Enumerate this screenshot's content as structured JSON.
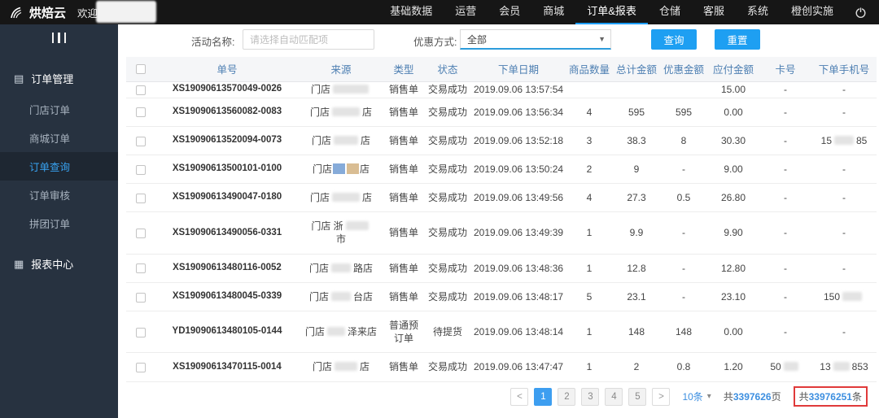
{
  "topnav": {
    "logo": "烘焙云",
    "welcome": "欢迎",
    "items": [
      {
        "label": "基础数据",
        "active": false
      },
      {
        "label": "运营",
        "active": false
      },
      {
        "label": "会员",
        "active": false
      },
      {
        "label": "商城",
        "active": false
      },
      {
        "label": "订单&报表",
        "active": true
      },
      {
        "label": "仓储",
        "active": false
      },
      {
        "label": "客服",
        "active": false
      },
      {
        "label": "系统",
        "active": false
      },
      {
        "label": "橙创实施",
        "active": false
      }
    ]
  },
  "sidebar": {
    "sections": [
      {
        "label": "订单管理",
        "icon": "orders-icon",
        "glyph": "▤",
        "items": [
          {
            "label": "门店订单",
            "active": false
          },
          {
            "label": "商城订单",
            "active": false
          },
          {
            "label": "订单查询",
            "active": true
          },
          {
            "label": "订单审核",
            "active": false
          },
          {
            "label": "拼团订单",
            "active": false
          }
        ]
      },
      {
        "label": "报表中心",
        "icon": "reports-icon",
        "glyph": "▦",
        "items": []
      }
    ]
  },
  "filters": {
    "activity_label": "活动名称:",
    "activity_placeholder": "请选择自动匹配项",
    "discount_label": "优惠方式:",
    "discount_value": "全部",
    "search_button": "查询",
    "reset_button": "重置"
  },
  "table": {
    "headers": [
      "单号",
      "来源",
      "类型",
      "状态",
      "下单日期",
      "商品数量",
      "总计金额",
      "优惠金额",
      "应付金额",
      "卡号",
      "下单手机号"
    ],
    "rows": [
      {
        "cut": true,
        "no": "XS19090613570049-0026",
        "source_pre": "门店",
        "source_blur": 44,
        "source_post": "",
        "type": "销售单",
        "status": "交易成功",
        "date": "2019.09.06 13:57:54",
        "qty": "",
        "total": "",
        "disc": "",
        "pay": "15.00",
        "card_pre": "-",
        "card_blur": 0,
        "card_post": "",
        "phone_pre": "-",
        "phone_blur": 0,
        "phone_post": ""
      },
      {
        "no": "XS19090613560082-0083",
        "source_pre": "门店",
        "source_blur": 34,
        "source_post": "店",
        "type": "销售单",
        "status": "交易成功",
        "date": "2019.09.06 13:56:34",
        "qty": "4",
        "total": "595",
        "disc": "595",
        "pay": "0.00",
        "card_pre": "-",
        "card_blur": 0,
        "card_post": "",
        "phone_pre": "-",
        "phone_blur": 0,
        "phone_post": ""
      },
      {
        "no": "XS19090613520094-0073",
        "source_pre": "门店",
        "source_blur": 30,
        "source_post": "店",
        "type": "销售单",
        "status": "交易成功",
        "date": "2019.09.06 13:52:18",
        "qty": "3",
        "total": "38.3",
        "disc": "8",
        "pay": "30.30",
        "card_pre": "-",
        "card_blur": 0,
        "card_post": "",
        "phone_pre": "15",
        "phone_blur": 24,
        "phone_post": "85"
      },
      {
        "no": "XS19090613500101-0100",
        "source_pre": "门店",
        "mosaic": true,
        "source_post": "店",
        "type": "销售单",
        "status": "交易成功",
        "date": "2019.09.06 13:50:24",
        "qty": "2",
        "total": "9",
        "disc": "-",
        "pay": "9.00",
        "card_pre": "-",
        "card_blur": 0,
        "card_post": "",
        "phone_pre": "-",
        "phone_blur": 0,
        "phone_post": ""
      },
      {
        "no": "XS19090613490047-0180",
        "source_pre": "门店",
        "source_blur": 34,
        "source_post": "店",
        "type": "销售单",
        "status": "交易成功",
        "date": "2019.09.06 13:49:56",
        "qty": "4",
        "total": "27.3",
        "disc": "0.5",
        "pay": "26.80",
        "card_pre": "-",
        "card_blur": 0,
        "card_post": "",
        "phone_pre": "-",
        "phone_blur": 0,
        "phone_post": ""
      },
      {
        "no": "XS19090613490056-0331",
        "source_pre": "门店 浙",
        "source_blur": 28,
        "source_wrap": true,
        "source_post": "市",
        "type": "销售单",
        "status": "交易成功",
        "date": "2019.09.06 13:49:39",
        "qty": "1",
        "total": "9.9",
        "disc": "-",
        "pay": "9.90",
        "card_pre": "-",
        "card_blur": 0,
        "card_post": "",
        "phone_pre": "-",
        "phone_blur": 0,
        "phone_post": ""
      },
      {
        "no": "XS19090613480116-0052",
        "source_pre": "门店",
        "source_blur": 24,
        "source_post": "路店",
        "type": "销售单",
        "status": "交易成功",
        "date": "2019.09.06 13:48:36",
        "qty": "1",
        "total": "12.8",
        "disc": "-",
        "pay": "12.80",
        "card_pre": "-",
        "card_blur": 0,
        "card_post": "",
        "phone_pre": "-",
        "phone_blur": 0,
        "phone_post": ""
      },
      {
        "no": "XS19090613480045-0339",
        "source_pre": "门店",
        "source_blur": 24,
        "source_post": "台店",
        "type": "销售单",
        "status": "交易成功",
        "date": "2019.09.06 13:48:17",
        "qty": "5",
        "total": "23.1",
        "disc": "-",
        "pay": "23.10",
        "card_pre": "-",
        "card_blur": 0,
        "card_post": "",
        "phone_pre": "150",
        "phone_blur": 24,
        "phone_post": ""
      },
      {
        "no": "YD19090613480105-0144",
        "source_pre": "门店",
        "source_blur": 22,
        "source_post": "泽来店",
        "type": "普通预订单",
        "status": "待提货",
        "date": "2019.09.06 13:48:14",
        "qty": "1",
        "total": "148",
        "disc": "148",
        "pay": "0.00",
        "card_pre": "-",
        "card_blur": 0,
        "card_post": "",
        "phone_pre": "-",
        "phone_blur": 0,
        "phone_post": ""
      },
      {
        "no": "XS19090613470115-0014",
        "source_pre": "门店",
        "source_blur": 28,
        "source_post": "店",
        "type": "销售单",
        "status": "交易成功",
        "date": "2019.09.06 13:47:47",
        "qty": "1",
        "total": "2",
        "disc": "0.8",
        "pay": "1.20",
        "card_pre": "50",
        "card_blur": 18,
        "card_post": "",
        "phone_pre": "13",
        "phone_blur": 20,
        "phone_post": "853"
      }
    ]
  },
  "pagination": {
    "prev": "<",
    "pages": [
      "1",
      "2",
      "3",
      "4",
      "5"
    ],
    "active_page": "1",
    "next": ">",
    "page_size": "10条",
    "total_pages_prefix": "共",
    "total_pages_num": "3397626",
    "total_pages_suffix": "页",
    "total_items_prefix": "共",
    "total_items_num": "33976251",
    "total_items_suffix": "条"
  },
  "icons": {
    "dropdown_arrow": "▼",
    "caret": "▾"
  },
  "colors": {
    "accent_blue": "#1e9ff2",
    "active_link_blue": "#38a3f2",
    "header_text_blue": "#4d7fb2",
    "annotation_red": "#e03a3a",
    "mosaic": [
      "#86abd9",
      "#d9bd93"
    ]
  }
}
